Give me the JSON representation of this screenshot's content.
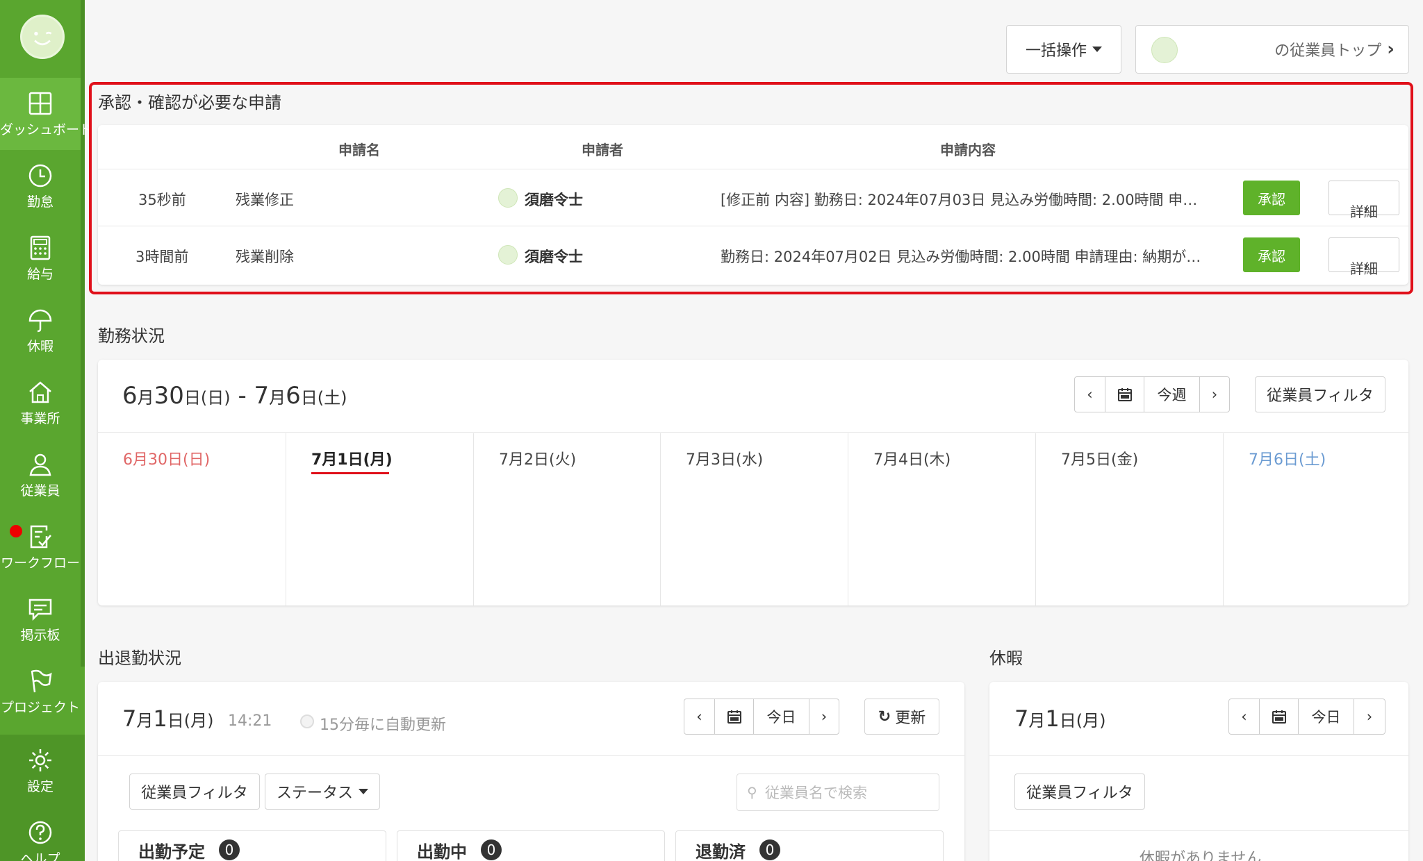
{
  "sidebar": {
    "items": [
      {
        "label": "ダッシュボード",
        "icon": "dashboard-icon"
      },
      {
        "label": "勤怠",
        "icon": "clock-icon"
      },
      {
        "label": "給与",
        "icon": "calculator-icon"
      },
      {
        "label": "休暇",
        "icon": "umbrella-icon"
      },
      {
        "label": "事業所",
        "icon": "home-icon"
      },
      {
        "label": "従業員",
        "icon": "person-icon"
      },
      {
        "label": "ワークフロー",
        "icon": "checklist-icon"
      },
      {
        "label": "掲示板",
        "icon": "message-icon"
      },
      {
        "label": "プロジェクト",
        "icon": "flag-icon"
      },
      {
        "label": "設定",
        "icon": "gear-icon"
      },
      {
        "label": "ヘルプ",
        "icon": "help-icon"
      }
    ]
  },
  "header": {
    "bulk_label": "一括操作",
    "employee_top_label": "の従業員トップ"
  },
  "approval": {
    "title": "承認・確認が必要な申請",
    "columns": {
      "name": "申請名",
      "applicant": "申請者",
      "content": "申請内容"
    },
    "rows": [
      {
        "time": "35秒前",
        "name": "残業修正",
        "applicant": "須磨令士",
        "content": "[修正前 内容] 勤務日: 2024年07月03日 見込み労働時間: 2.00時間 申…",
        "approve": "承認",
        "detail": "詳細"
      },
      {
        "time": "3時間前",
        "name": "残業削除",
        "applicant": "須磨令士",
        "content": "勤務日: 2024年07月02日 見込み労働時間: 2.00時間 申請理由: 納期が…",
        "approve": "承認",
        "detail": "詳細"
      }
    ]
  },
  "work_status": {
    "title": "勤務状況",
    "range": {
      "start_num": "6",
      "start_m": "月",
      "start_d": "30",
      "start_suffix": "日(日)",
      "sep": " - ",
      "end_num": "7",
      "end_m": "月",
      "end_d": "6",
      "end_suffix": "日(土)"
    },
    "this_week": "今週",
    "filter": "従業員フィルタ",
    "days": [
      {
        "label": "6月30日(日)",
        "color": "#e06666"
      },
      {
        "label": "7月1日(月)",
        "color": "#222222"
      },
      {
        "label": "7月2日(火)",
        "color": "#444444"
      },
      {
        "label": "7月3日(水)",
        "color": "#444444"
      },
      {
        "label": "7月4日(木)",
        "color": "#444444"
      },
      {
        "label": "7月5日(金)",
        "color": "#444444"
      },
      {
        "label": "7月6日(土)",
        "color": "#6b9bd2"
      }
    ]
  },
  "attendance": {
    "title": "出退勤状況",
    "date_m": "7",
    "date_d": "1",
    "date_suffix": "日(月)",
    "month_char": "月",
    "time": "14:21",
    "auto_refresh": "15分毎に自動更新",
    "today": "今日",
    "refresh": "更新",
    "filter": "従業員フィルタ",
    "status": "ステータス",
    "search_placeholder": "従業員名で検索",
    "stats": [
      {
        "label": "出勤予定",
        "count": "0"
      },
      {
        "label": "出勤中",
        "count": "0"
      },
      {
        "label": "退勤済",
        "count": "0"
      }
    ]
  },
  "leave": {
    "title": "休暇",
    "date_m": "7",
    "date_d": "1",
    "date_suffix": "日(月)",
    "month_char": "月",
    "today": "今日",
    "filter": "従業員フィルタ",
    "empty": "休暇がありません"
  },
  "colors": {
    "brand": "#5aa62f",
    "approve": "#5fb22a",
    "highlight": "#e0101a"
  }
}
